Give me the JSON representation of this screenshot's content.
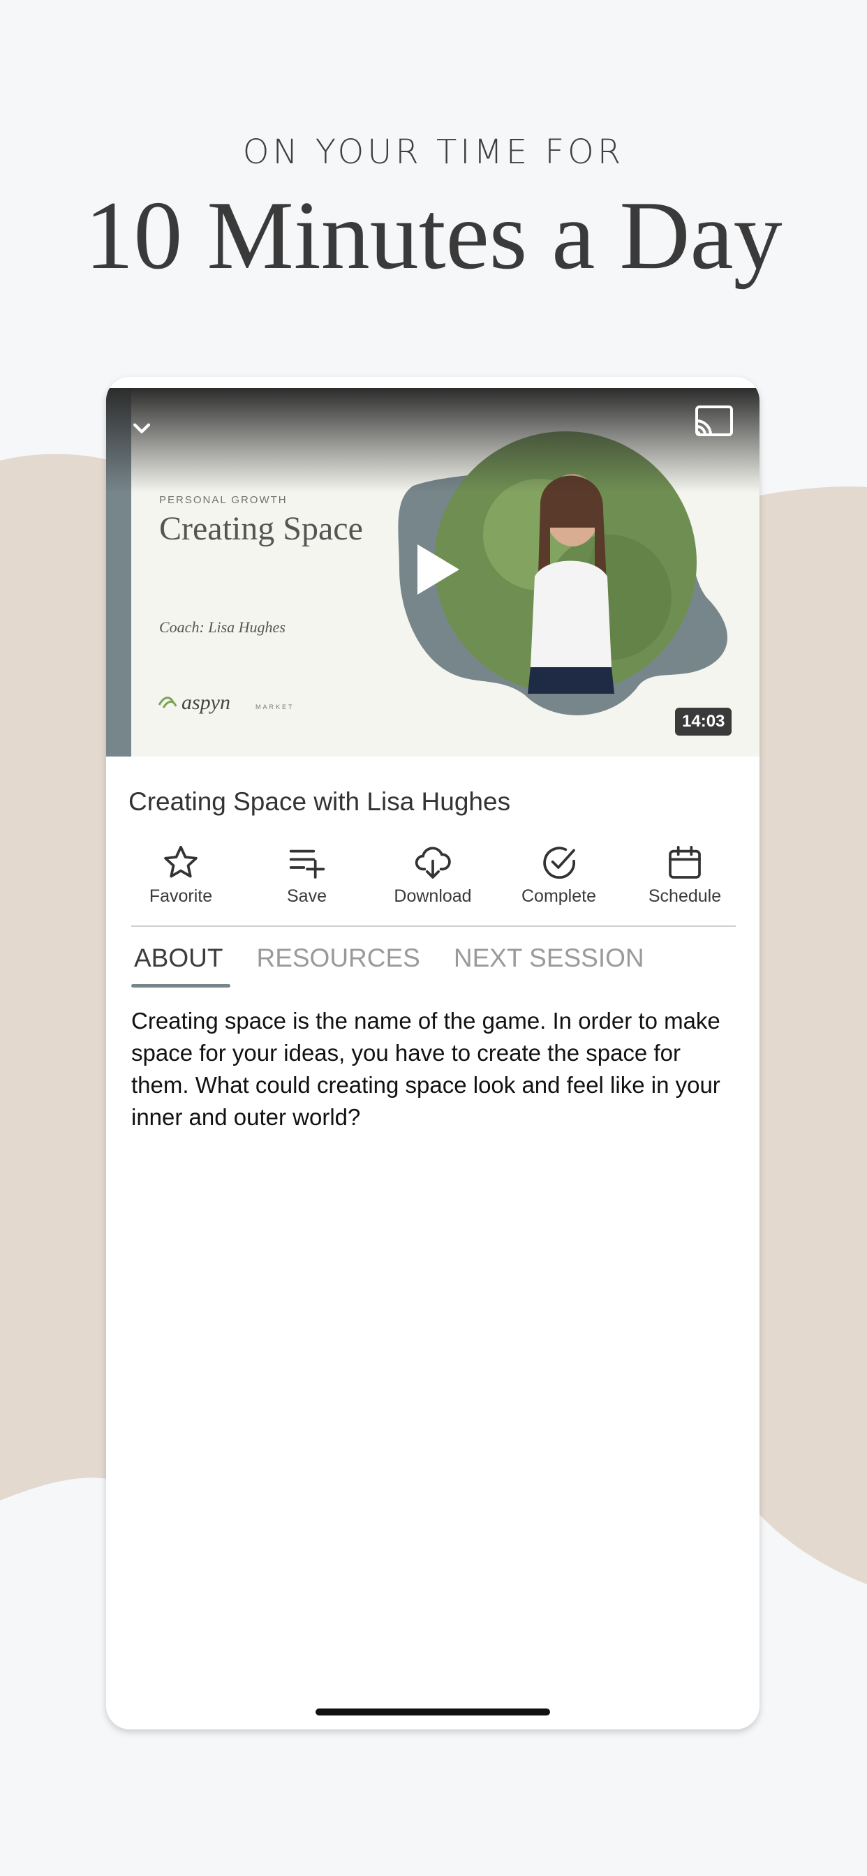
{
  "headline": {
    "subtitle": "ON YOUR TIME FOR",
    "title": "10 Minutes a Day"
  },
  "video": {
    "category": "PERSONAL GROWTH",
    "title": "Creating Space",
    "coach": "Coach: Lisa Hughes",
    "duration": "14:03",
    "collapse_icon": "chevron-down-icon",
    "cast_icon": "cast-icon",
    "play_icon": "play-icon"
  },
  "session": {
    "title": "Creating Space with Lisa Hughes"
  },
  "actions": [
    {
      "label": "Favorite",
      "icon": "star-icon"
    },
    {
      "label": "Save",
      "icon": "playlist-add-icon"
    },
    {
      "label": "Download",
      "icon": "cloud-download-icon"
    },
    {
      "label": "Complete",
      "icon": "check-circle-icon"
    },
    {
      "label": "Schedule",
      "icon": "calendar-icon"
    }
  ],
  "tabs": [
    {
      "label": "ABOUT",
      "active": true
    },
    {
      "label": "RESOURCES",
      "active": false
    },
    {
      "label": "NEXT SESSION",
      "active": false
    }
  ],
  "about": {
    "text": "Creating space is the name of the game. In order to make space for your ideas, you have to create the space for them. What could creating space look and feel like in your inner and outer world?"
  },
  "colors": {
    "accent": "#77868b",
    "background": "#f5f7f9",
    "beige": "#e3d9cf"
  }
}
